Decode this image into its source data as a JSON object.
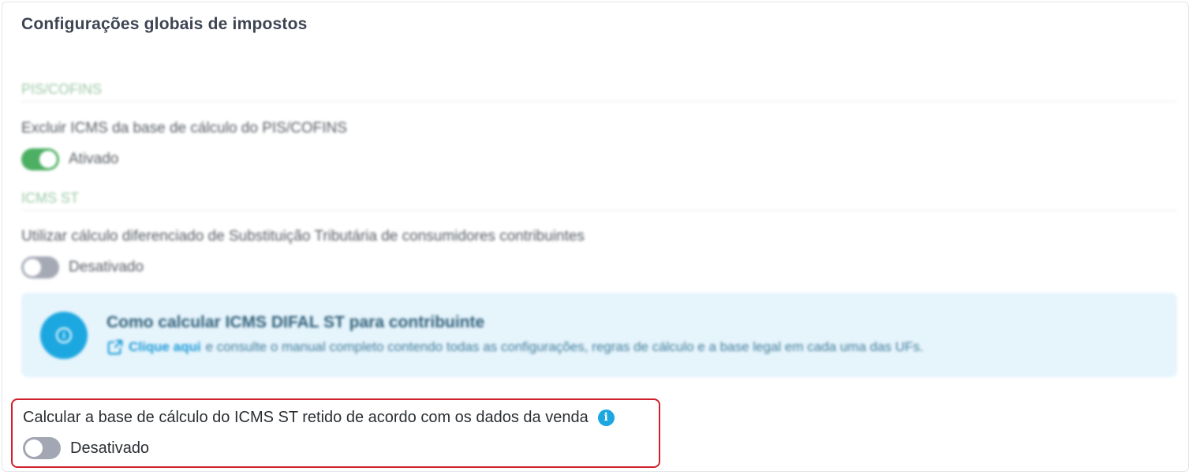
{
  "page": {
    "title": "Configurações globais de impostos"
  },
  "pis_cofins": {
    "section_title": "PIS/COFINS",
    "field_label": "Excluir ICMS da base de cálculo do PIS/COFINS",
    "toggle_state": "Ativado",
    "enabled": true
  },
  "icms_st": {
    "section_title": "ICMS ST",
    "field_label": "Utilizar cálculo diferenciado de Substituição Tributária de consumidores contribuintes",
    "toggle_state": "Desativado",
    "enabled": false
  },
  "info_banner": {
    "title": "Como calcular ICMS DIFAL ST para contribuinte",
    "link_text": "Clique aqui",
    "description": "e consulte o manual completo contendo todas as configurações, regras de cálculo e a base legal em cada uma das UFs."
  },
  "retained_base": {
    "field_label": "Calcular a base de cálculo do ICMS ST retido de acordo com os dados da venda",
    "info_icon_glyph": "i",
    "toggle_state": "Desativado",
    "enabled": false
  },
  "colors": {
    "toggle_on": "#4caf63",
    "toggle_off": "#a4a9b4",
    "info_blue": "#1da7e0",
    "highlight_border": "#d0202a",
    "banner_bg": "#e6f4fc"
  }
}
